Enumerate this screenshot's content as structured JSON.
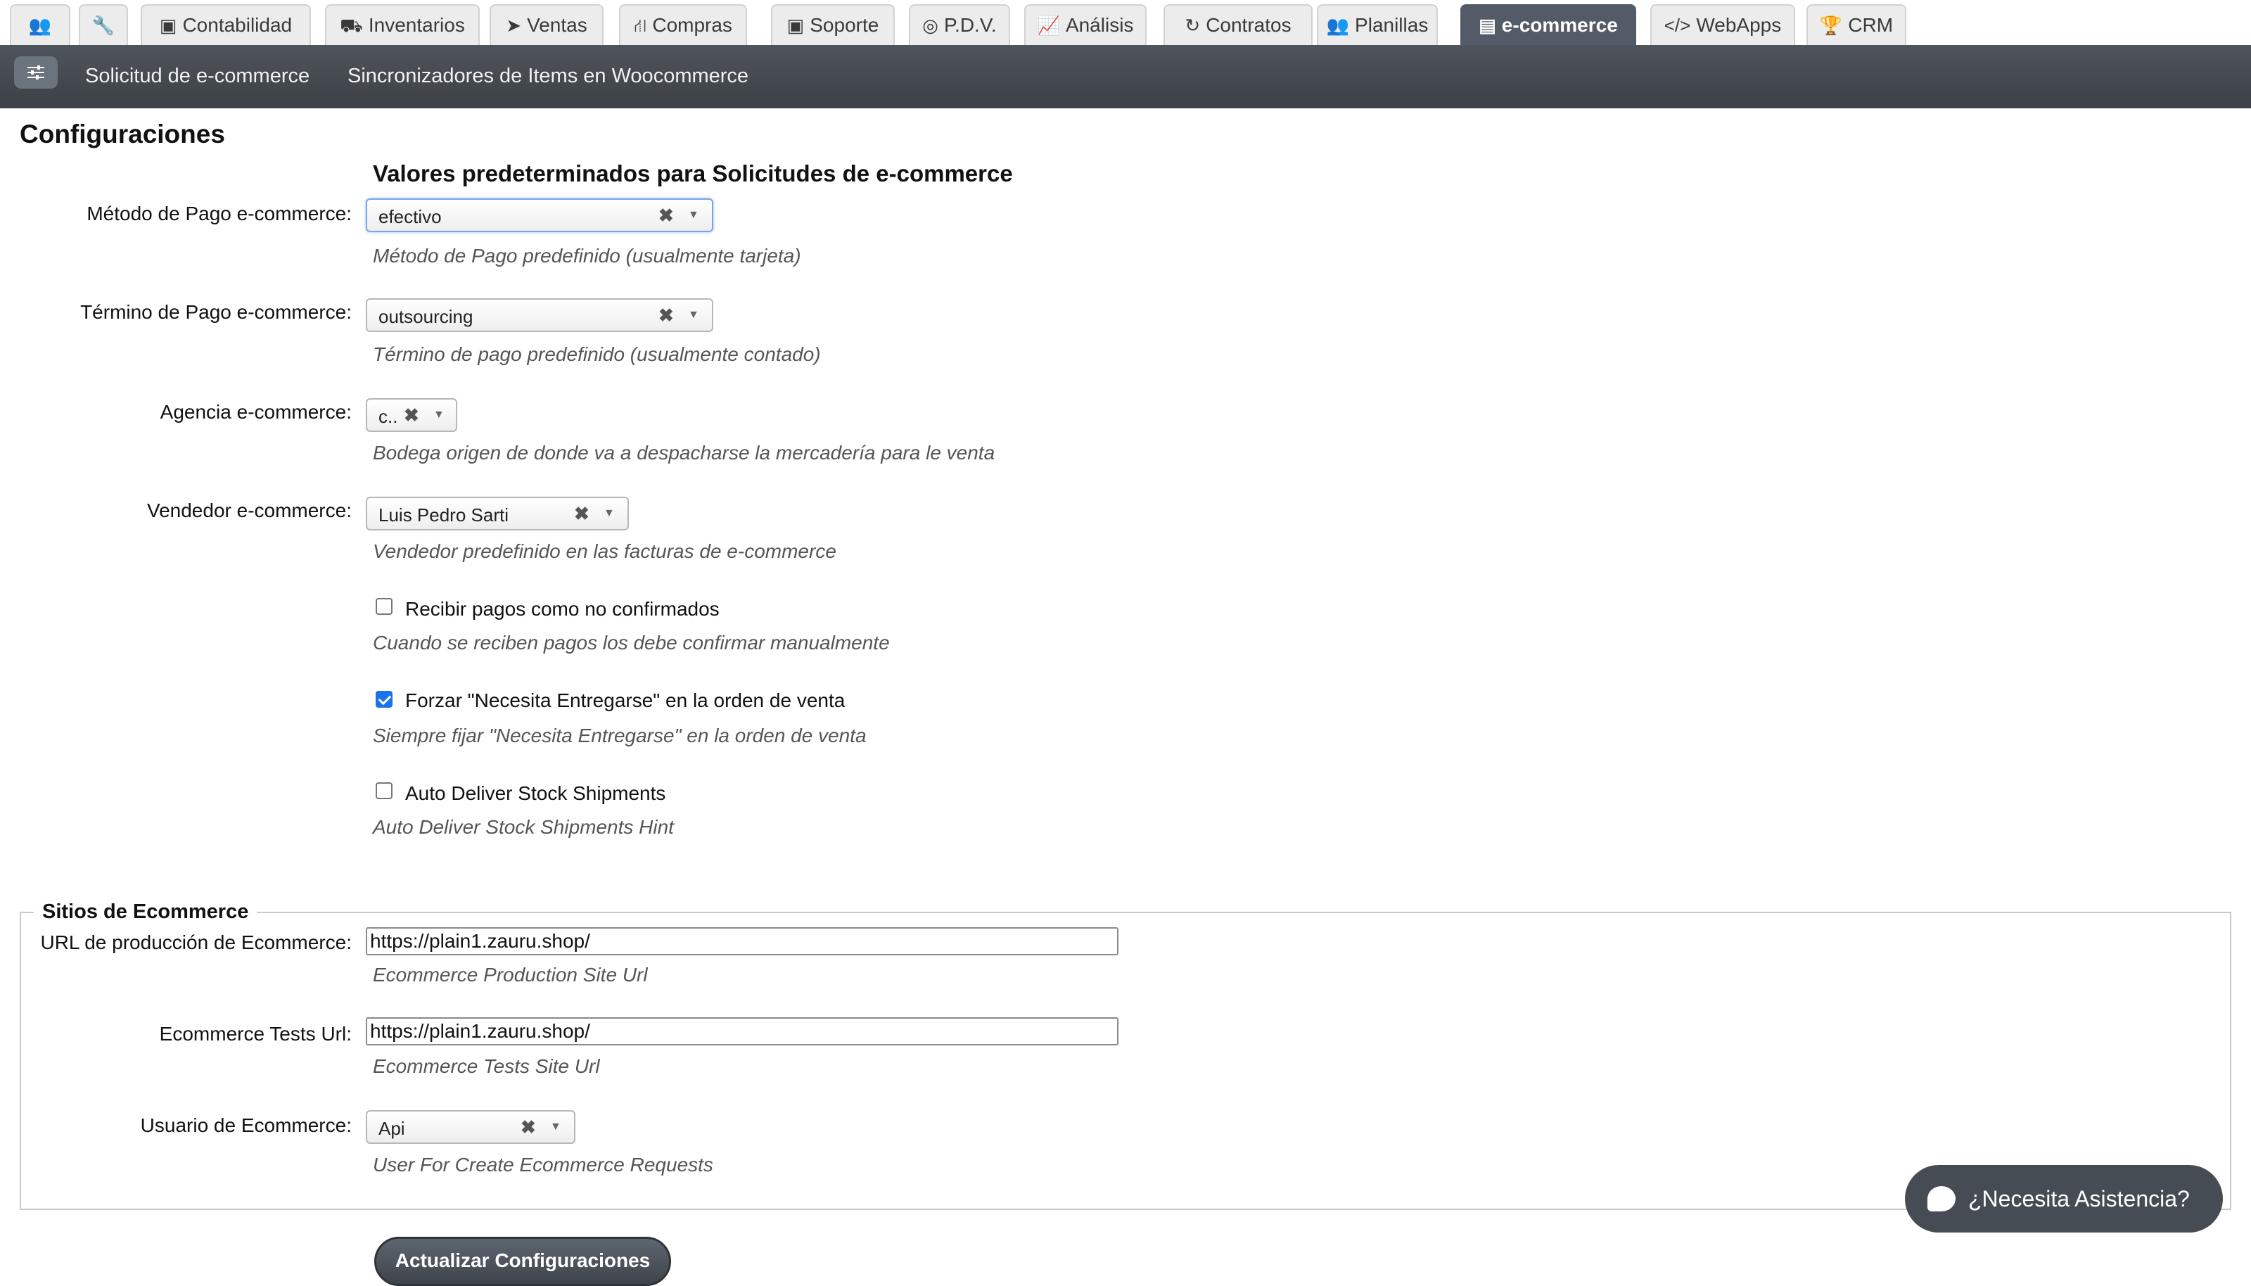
{
  "tabs": [
    {
      "label": "",
      "icon": "users-icon",
      "active": false
    },
    {
      "label": "",
      "icon": "wrench-icon",
      "active": false
    },
    {
      "label": "Contabilidad",
      "icon": "money-icon",
      "active": false
    },
    {
      "label": "Inventarios",
      "icon": "truck-icon",
      "active": false
    },
    {
      "label": "Ventas",
      "icon": "tags-icon",
      "active": false
    },
    {
      "label": "Compras",
      "icon": "cart-icon",
      "active": false
    },
    {
      "label": "Soporte",
      "icon": "camera-icon",
      "active": false
    },
    {
      "label": "P.D.V.",
      "icon": "target-icon",
      "active": false
    },
    {
      "label": "Análisis",
      "icon": "chart-icon",
      "active": false
    },
    {
      "label": "Contratos",
      "icon": "refresh-icon",
      "active": false
    },
    {
      "label": "Planillas",
      "icon": "users-icon",
      "active": false
    },
    {
      "label": "e-commerce",
      "icon": "credit-card-icon",
      "active": true
    },
    {
      "label": "WebApps",
      "icon": "code-icon",
      "active": false
    },
    {
      "label": "CRM",
      "icon": "trophy-icon",
      "active": false
    }
  ],
  "subnav": {
    "menu_icon": "sliders-icon",
    "links": [
      "Solicitud de e-commerce",
      "Sincronizadores de Items en Woocommerce"
    ]
  },
  "page": {
    "title": "Configuraciones",
    "section_title": "Valores predeterminados para Solicitudes de e-commerce"
  },
  "fields": {
    "payment_method": {
      "label": "Método de Pago e-commerce:",
      "value": "efectivo",
      "hint": "Método de Pago predefinido (usualmente tarjeta)"
    },
    "payment_term": {
      "label": "Término de Pago e-commerce:",
      "value": "outsourcing",
      "hint": "Término de pago predefinido (usualmente contado)"
    },
    "agency": {
      "label": "Agencia e-commerce:",
      "value": "c..",
      "hint": "Bodega origen de donde va a despacharse la mercadería para le venta"
    },
    "seller": {
      "label": "Vendedor e-commerce:",
      "value": "Luis Pedro Sarti",
      "hint": "Vendedor predefinido en las facturas de e-commerce"
    }
  },
  "checkboxes": {
    "unconfirmed": {
      "label": "Recibir pagos como no confirmados",
      "hint": "Cuando se reciben pagos los debe confirmar manualmente",
      "checked": false
    },
    "force_delivery": {
      "label": "Forzar \"Necesita Entregarse\" en la orden de venta",
      "hint": "Siempre fijar \"Necesita Entregarse\" en la orden de venta",
      "checked": true
    },
    "auto_deliver": {
      "label": "Auto Deliver Stock Shipments",
      "hint": "Auto Deliver Stock Shipments Hint",
      "checked": false
    }
  },
  "sites": {
    "legend": "Sitios de Ecommerce",
    "production_url": {
      "label": "URL de producción de Ecommerce:",
      "value": "https://plain1.zauru.shop/",
      "hint": "Ecommerce Production Site Url"
    },
    "tests_url": {
      "label": "Ecommerce Tests Url:",
      "value": "https://plain1.zauru.shop/",
      "hint": "Ecommerce Tests Site Url"
    },
    "user": {
      "label": "Usuario de Ecommerce:",
      "value": "Api",
      "hint": "User For Create Ecommerce Requests"
    }
  },
  "submit_label": "Actualizar Configuraciones",
  "help_label": "¿Necesita Asistencia?",
  "colors": {
    "active_tab": "#535c66",
    "subnav": "#3b4046",
    "checkbox_checked": "#1a73e8"
  }
}
